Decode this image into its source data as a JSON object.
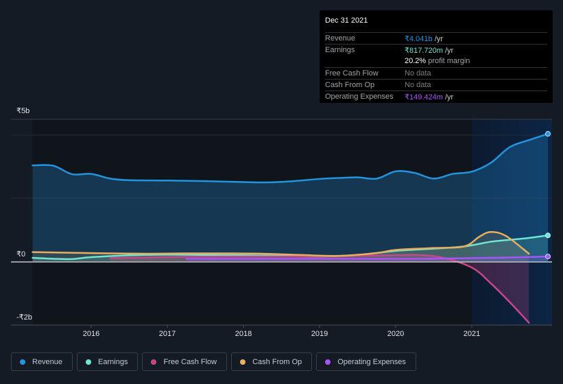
{
  "tooltip": {
    "date": "Dec 31 2021",
    "rows": [
      {
        "label": "Revenue",
        "value": "₹4.041b",
        "unit": " /yr",
        "color": "#2394df"
      },
      {
        "label": "Earnings",
        "value": "₹817.720m",
        "unit": " /yr",
        "color": "#6ee7d2"
      },
      {
        "label": "",
        "value": "20.2%",
        "unit": " profit margin",
        "color": "#ffffff"
      },
      {
        "label": "Free Cash Flow",
        "value": "No data",
        "unit": "",
        "color": "#7a7d82"
      },
      {
        "label": "Cash From Op",
        "value": "No data",
        "unit": "",
        "color": "#7a7d82"
      },
      {
        "label": "Operating Expenses",
        "value": "₹149.424m",
        "unit": " /yr",
        "color": "#a855f7"
      }
    ]
  },
  "legend": [
    {
      "label": "Revenue",
      "color": "#2394df"
    },
    {
      "label": "Earnings",
      "color": "#6ee7d2"
    },
    {
      "label": "Free Cash Flow",
      "color": "#c8478b"
    },
    {
      "label": "Cash From Op",
      "color": "#e9ae60"
    },
    {
      "label": "Operating Expenses",
      "color": "#a855f7"
    }
  ],
  "chart_data": {
    "type": "area",
    "title": "",
    "xlabel": "",
    "ylabel": "",
    "y_tick_labels": [
      "₹5b",
      "₹0",
      "-₹2b"
    ],
    "x_tick_labels": [
      "2016",
      "2017",
      "2018",
      "2019",
      "2020",
      "2021"
    ],
    "x_ticks": [
      2016,
      2017,
      2018,
      2019,
      2020,
      2021
    ],
    "xlim": [
      2015.0,
      2022.0
    ],
    "ylim": [
      -2.0,
      4.5
    ],
    "y_units": "₹ billions",
    "gridlines": [
      2,
      4
    ],
    "highlight_start": 2021.0,
    "legend_position": "bottom",
    "series": [
      {
        "name": "Revenue",
        "color": "#2394df",
        "x": [
          2015.23,
          2015.5,
          2015.75,
          2016.0,
          2016.25,
          2016.5,
          2017.0,
          2017.5,
          2018.0,
          2018.3,
          2018.6,
          2019.0,
          2019.25,
          2019.5,
          2019.75,
          2020.0,
          2020.25,
          2020.5,
          2020.75,
          2021.0,
          2021.25,
          2021.5,
          2021.75,
          2022.0
        ],
        "values": [
          3.04,
          3.03,
          2.76,
          2.77,
          2.62,
          2.57,
          2.56,
          2.54,
          2.51,
          2.5,
          2.53,
          2.61,
          2.64,
          2.66,
          2.62,
          2.85,
          2.8,
          2.62,
          2.77,
          2.84,
          3.12,
          3.62,
          3.84,
          4.04
        ]
      },
      {
        "name": "Earnings",
        "color": "#6ee7d2",
        "x": [
          2015.23,
          2015.5,
          2015.75,
          2016.0,
          2016.5,
          2017.0,
          2017.5,
          2018.0,
          2018.5,
          2019.0,
          2019.5,
          2020.0,
          2020.5,
          2020.9,
          2021.25,
          2021.5,
          2021.75,
          2022.0
        ],
        "values": [
          0.11,
          0.08,
          0.07,
          0.13,
          0.19,
          0.21,
          0.2,
          0.19,
          0.17,
          0.15,
          0.2,
          0.33,
          0.4,
          0.47,
          0.62,
          0.68,
          0.74,
          0.82
        ]
      },
      {
        "name": "Free Cash Flow",
        "color": "#c8478b",
        "x": [
          2016.25,
          2016.75,
          2017.25,
          2017.75,
          2018.25,
          2018.75,
          2019.25,
          2019.75,
          2020.25,
          2020.6,
          2021.0,
          2021.25,
          2021.5,
          2021.75
        ],
        "values": [
          0.1,
          0.12,
          0.14,
          0.15,
          0.15,
          0.15,
          0.16,
          0.18,
          0.2,
          0.12,
          -0.2,
          -0.7,
          -1.3,
          -1.95
        ]
      },
      {
        "name": "Cash From Op",
        "color": "#e9ae60",
        "x": [
          2015.23,
          2015.75,
          2016.25,
          2016.75,
          2017.25,
          2017.75,
          2018.25,
          2018.75,
          2019.25,
          2019.75,
          2020.0,
          2020.5,
          2020.9,
          2021.1,
          2021.25,
          2021.45,
          2021.75
        ],
        "values": [
          0.29,
          0.27,
          0.25,
          0.24,
          0.25,
          0.25,
          0.24,
          0.2,
          0.17,
          0.26,
          0.36,
          0.42,
          0.47,
          0.78,
          0.93,
          0.8,
          0.24
        ]
      },
      {
        "name": "Operating Expenses",
        "color": "#a855f7",
        "x": [
          2017.25,
          2017.75,
          2018.25,
          2018.75,
          2019.25,
          2019.75,
          2020.25,
          2020.75,
          2021.0,
          2021.5,
          2022.0
        ],
        "values": [
          0.08,
          0.08,
          0.08,
          0.08,
          0.08,
          0.08,
          0.08,
          0.09,
          0.1,
          0.12,
          0.15
        ]
      }
    ]
  }
}
